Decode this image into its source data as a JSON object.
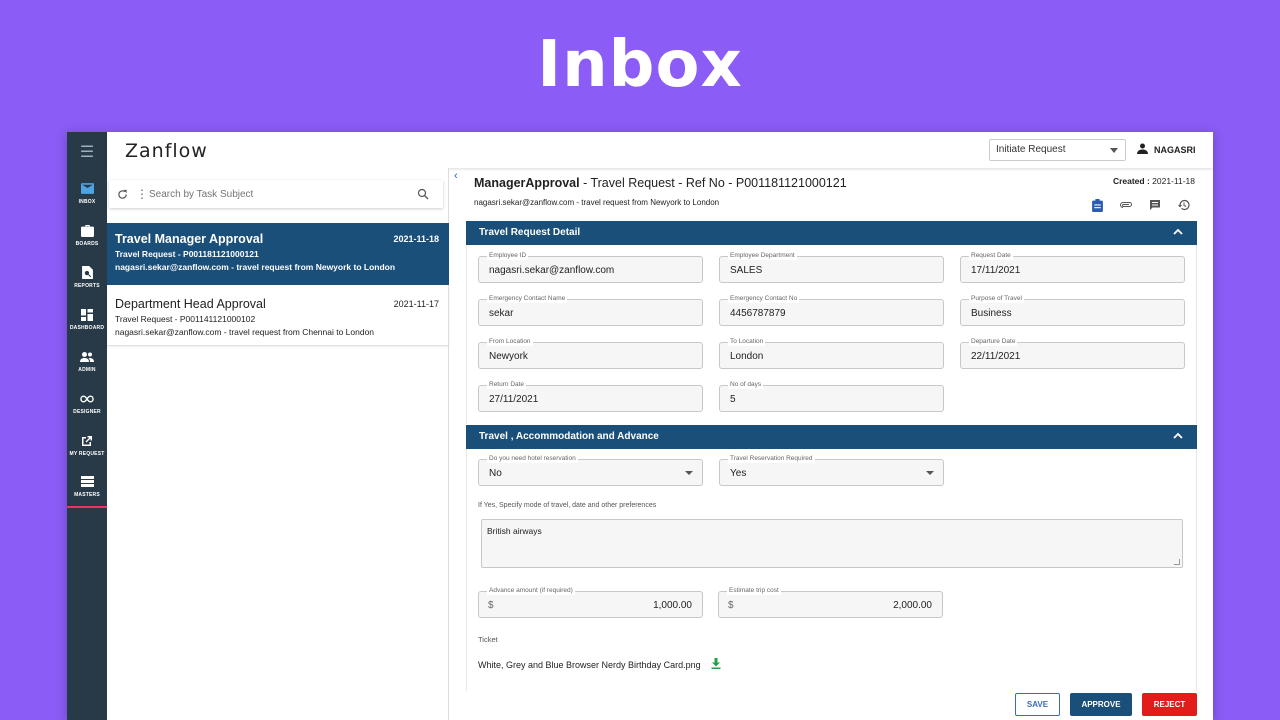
{
  "banner": {
    "title": "Inbox"
  },
  "app": {
    "logo": "Zanflow"
  },
  "topbar": {
    "initiate_label": "Initiate Request",
    "user_name": "NAGASRI"
  },
  "sidebar": {
    "items": [
      {
        "label": "INBOX",
        "icon": "mail-icon"
      },
      {
        "label": "BOARDS",
        "icon": "briefcase-icon"
      },
      {
        "label": "REPORTS",
        "icon": "report-icon"
      },
      {
        "label": "DASHBOARD",
        "icon": "dashboard-icon"
      },
      {
        "label": "ADMIN",
        "icon": "people-icon"
      },
      {
        "label": "DESIGNER",
        "icon": "infinity-icon"
      },
      {
        "label": "MY REQUEST",
        "icon": "open-in-new-icon"
      },
      {
        "label": "MASTERS",
        "icon": "list-icon"
      }
    ]
  },
  "search": {
    "placeholder": "Search by Task Subject"
  },
  "tasks": [
    {
      "title": "Travel Manager Approval",
      "date": "2021-11-18",
      "ref": "Travel Request - P001181121000121",
      "desc": "nagasri.sekar@zanflow.com - travel request from Newyork to London"
    },
    {
      "title": "Department Head Approval",
      "date": "2021-11-17",
      "ref": "Travel Request - P001141121000102",
      "desc": "nagasri.sekar@zanflow.com - travel request from Chennai to London"
    }
  ],
  "detail": {
    "title_bold": "ManagerApproval",
    "title_rest": " - Travel Request - Ref No - P001181121000121",
    "subtitle": "nagasri.sekar@zanflow.com - travel request from Newyork to London",
    "created_label": "Created :",
    "created_date": " 2021-11-18"
  },
  "section1": {
    "title": "Travel Request Detail",
    "fields": {
      "employee_id": {
        "label": "Employee ID",
        "value": "nagasri.sekar@zanflow.com"
      },
      "employee_department": {
        "label": "Employee Department",
        "value": "SALES"
      },
      "request_date": {
        "label": "Request Date",
        "value": "17/11/2021"
      },
      "emergency_contact_name": {
        "label": "Emergency Contact Name",
        "value": "sekar"
      },
      "emergency_contact_no": {
        "label": "Emergency Contact No",
        "value": "4456787879"
      },
      "purpose_of_travel": {
        "label": "Purpose of Travel",
        "value": "Business"
      },
      "from_location": {
        "label": "From Location",
        "value": "Newyork"
      },
      "to_location": {
        "label": "To Location",
        "value": "London"
      },
      "departure_date": {
        "label": "Departure Date",
        "value": "22/11/2021"
      },
      "return_date": {
        "label": "Return Date",
        "value": "27/11/2021"
      },
      "no_of_days": {
        "label": "No of days",
        "value": "5"
      }
    }
  },
  "section2": {
    "title": "Travel , Accommodation and Advance",
    "hotel": {
      "label": "Do you need hotel reservation",
      "value": "No"
    },
    "travel_reservation": {
      "label": "Travel Reservation Required",
      "value": "Yes"
    },
    "preferences_note": "If Yes, Specify mode of travel, date and other preferences",
    "preferences_value": "British airways",
    "advance": {
      "label": "Advance amount (if required)",
      "currency": "$",
      "value": "1,000.00"
    },
    "estimate": {
      "label": "Estimate trip cost",
      "currency": "$",
      "value": "2,000.00"
    },
    "ticket_label": "Ticket",
    "ticket_file": "White, Grey and Blue Browser Nerdy Birthday Card.png"
  },
  "actions": {
    "save": "SAVE",
    "approve": "APPROVE",
    "reject": "REJECT"
  },
  "colors": {
    "brand": "#1a4f7a",
    "banner": "#8b5cf6",
    "reject": "#e21b1b",
    "sidebar": "#283a47"
  }
}
